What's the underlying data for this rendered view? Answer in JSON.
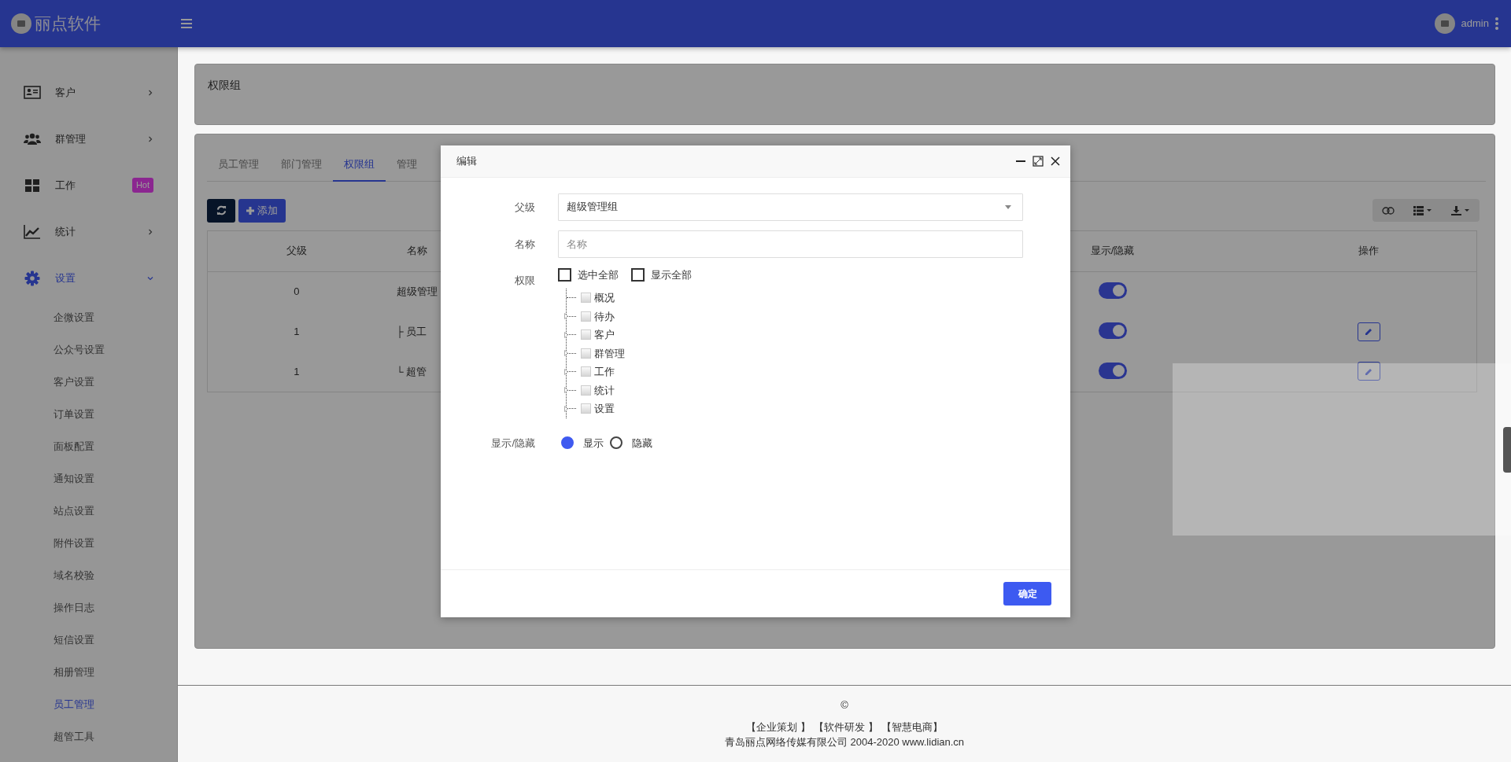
{
  "brand": {
    "name": "丽点软件"
  },
  "topbar": {
    "user": "admin"
  },
  "sidebar": {
    "items": [
      {
        "label": "客户",
        "selected": false,
        "expanded": false
      },
      {
        "label": "群管理",
        "selected": false,
        "expanded": false
      },
      {
        "label": "工作",
        "selected": false,
        "badge": "Hot"
      },
      {
        "label": "统计",
        "selected": false,
        "expanded": false
      },
      {
        "label": "设置",
        "selected": true,
        "expanded": true,
        "children": [
          {
            "label": "企微设置",
            "selected": false
          },
          {
            "label": "公众号设置",
            "selected": false
          },
          {
            "label": "客户设置",
            "selected": false
          },
          {
            "label": "订单设置",
            "selected": false
          },
          {
            "label": "面板配置",
            "selected": false
          },
          {
            "label": "通知设置",
            "selected": false
          },
          {
            "label": "站点设置",
            "selected": false
          },
          {
            "label": "附件设置",
            "selected": false
          },
          {
            "label": "域名校验",
            "selected": false
          },
          {
            "label": "操作日志",
            "selected": false
          },
          {
            "label": "短信设置",
            "selected": false
          },
          {
            "label": "相册管理",
            "selected": false
          },
          {
            "label": "员工管理",
            "selected": true
          },
          {
            "label": "超管工具",
            "selected": false
          }
        ]
      }
    ]
  },
  "page_header": {
    "title": "权限组"
  },
  "tabs": [
    {
      "label": "员工管理",
      "selected": false
    },
    {
      "label": "部门管理",
      "selected": false
    },
    {
      "label": "权限组",
      "selected": true
    },
    {
      "label": "管理",
      "selected": false
    }
  ],
  "toolbar": {
    "add_button": "添加"
  },
  "table": {
    "columns": [
      "父级",
      "名称",
      "显示/隐藏",
      "操作"
    ],
    "rows": [
      {
        "parent": "0",
        "name": "超级管理",
        "visible": true,
        "editable": false
      },
      {
        "parent": "1",
        "name": "├ 员工",
        "visible": true,
        "editable": true
      },
      {
        "parent": "1",
        "name": "└ 超管",
        "visible": true,
        "editable": true
      }
    ]
  },
  "modal": {
    "title": "编辑",
    "fields": [
      {
        "kind": "select",
        "label": "父级",
        "value": "超级管理组"
      },
      {
        "kind": "text",
        "label": "名称",
        "placeholder": "名称"
      },
      {
        "kind": "permissions",
        "label": "权限",
        "options": [
          {
            "label": "选中全部",
            "checked": false
          },
          {
            "label": "显示全部",
            "checked": false
          }
        ],
        "tree": [
          {
            "label": "概况",
            "checked": false
          },
          {
            "label": "待办",
            "checked": false,
            "expanded": false
          },
          {
            "label": "客户",
            "checked": false,
            "expanded": false
          },
          {
            "label": "群管理",
            "checked": false,
            "expanded": false
          },
          {
            "label": "工作",
            "checked": false,
            "expanded": false
          },
          {
            "label": "统计",
            "checked": false,
            "expanded": false
          },
          {
            "label": "设置",
            "checked": false,
            "expanded": false
          }
        ]
      },
      {
        "kind": "radio",
        "label": "显示/隐藏",
        "options": [
          {
            "label": "显示",
            "selected": true
          },
          {
            "label": "隐藏",
            "selected": false
          }
        ]
      }
    ],
    "confirm": "确定"
  },
  "footer": {
    "copyright": "©",
    "links": [
      "【企业策划 】",
      "【软件研发 】",
      "【智慧电商】"
    ],
    "company": "青岛丽点网络传媒有限公司 2004-2020 www.lidian.cn"
  }
}
